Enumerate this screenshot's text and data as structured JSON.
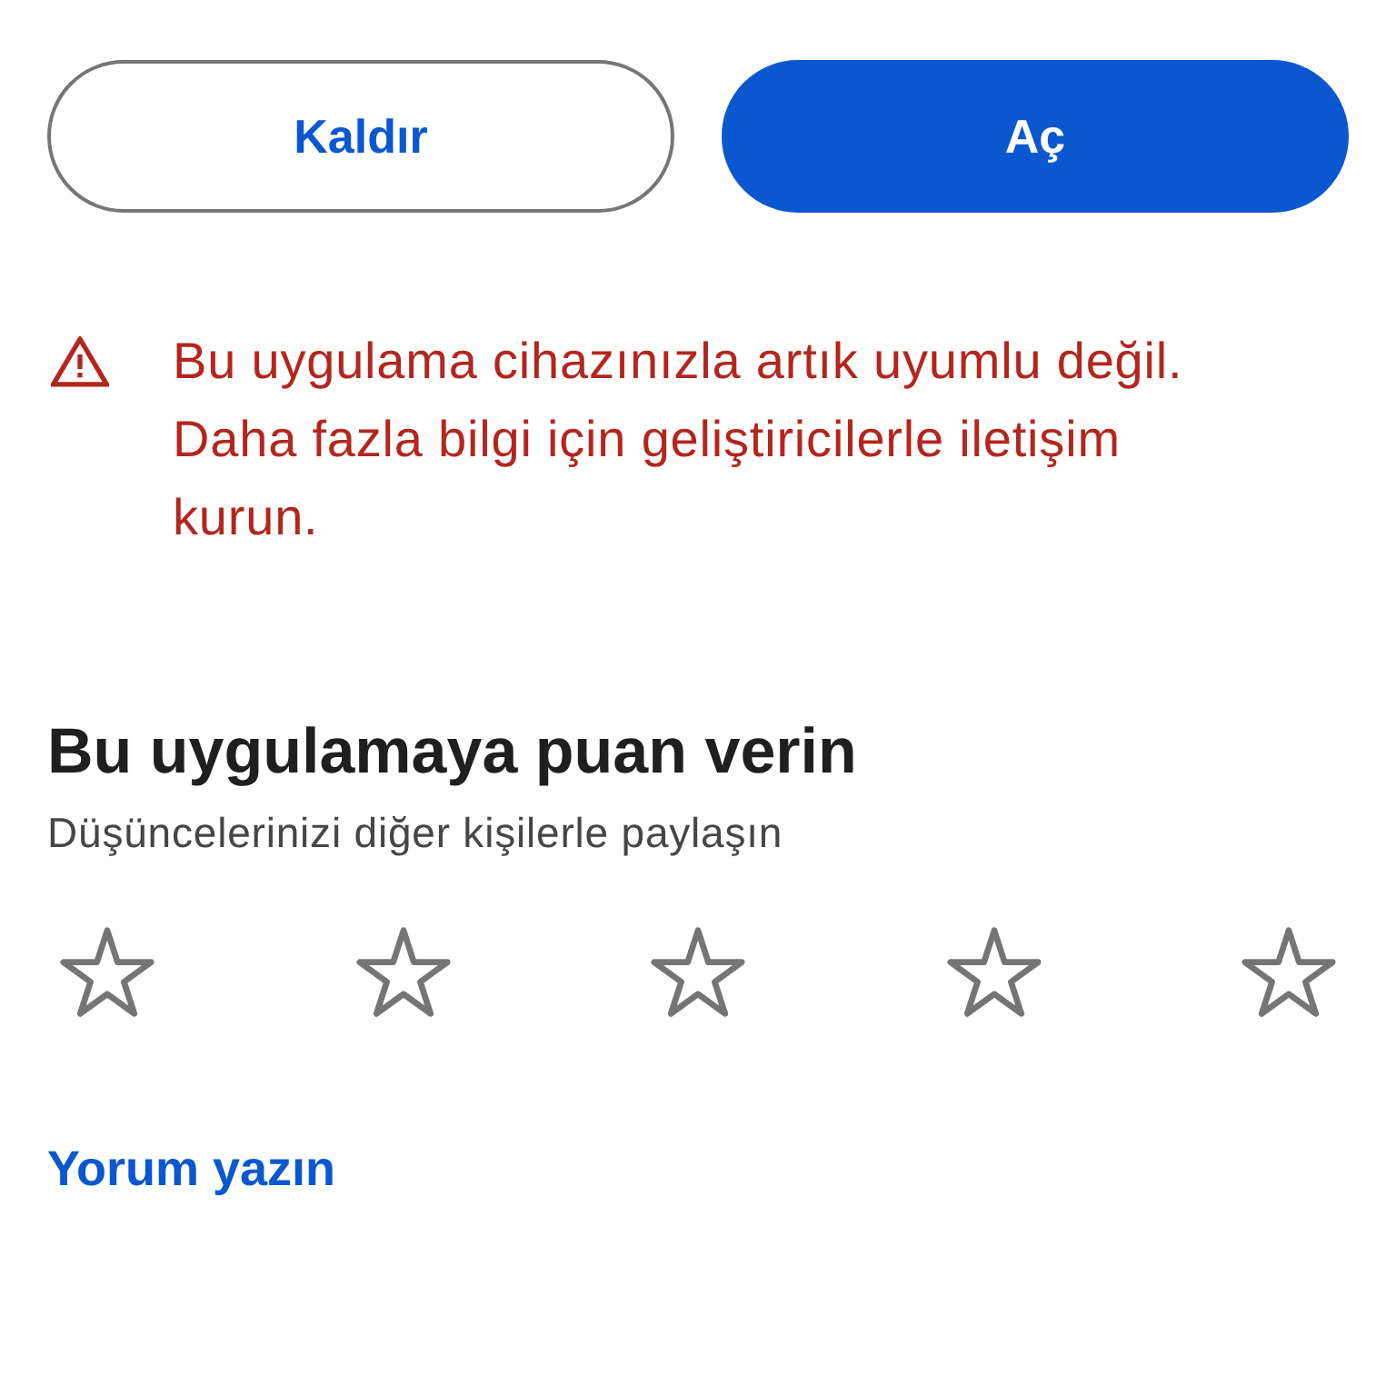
{
  "actions": {
    "buttons": [
      {
        "label": "Kaldır",
        "kind": "outlined"
      },
      {
        "label": "Aç",
        "kind": "filled"
      }
    ]
  },
  "warning": {
    "text": "Bu uygulama cihazınızla artık uyumlu değil. Daha fazla bilgi için geliştiricilerle iletişim kurun."
  },
  "rating": {
    "title": "Bu uygulamaya puan verin",
    "subtitle": "Düşüncelerinizi diğer kişilerle paylaşın",
    "stars": 0
  },
  "review_link": {
    "label": "Yorum yazın"
  }
}
